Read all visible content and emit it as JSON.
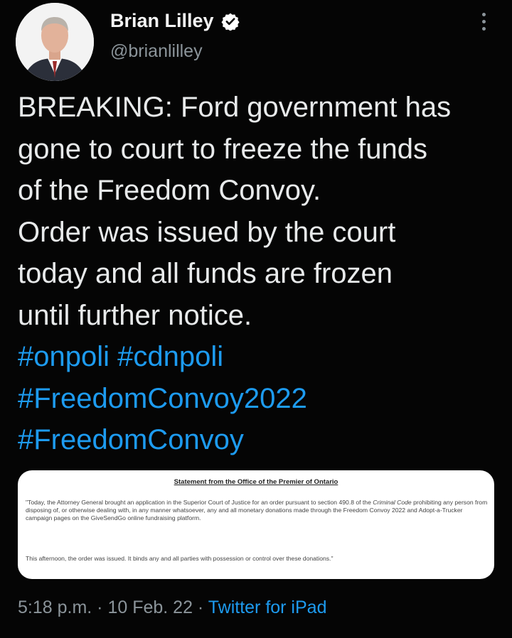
{
  "author": {
    "name": "Brian Lilley",
    "handle": "@brianlilley",
    "verified_icon": "verified-badge-icon",
    "colors": {
      "verified": "#ffffff",
      "handle": "#8b949a"
    }
  },
  "tweet": {
    "lines": [
      "BREAKING: Ford government has",
      "gone to court to freeze the funds",
      "of the Freedom Convoy.",
      "Order was issued by the court",
      "today and all funds are frozen",
      "until further notice."
    ],
    "hashtags": {
      "line1_a": "#onpoli",
      "line1_b": "#cdnpoli",
      "line2": "#FreedomConvoy2022",
      "line3": "#FreedomConvoy"
    }
  },
  "attachment": {
    "title": "Statement from the Office of the Premier of Ontario",
    "paragraph1_a": "\"Today, the Attorney General brought an application in the Superior Court of Justice for an order pursuant to section 490.8 of the ",
    "paragraph1_italic": "Criminal Code",
    "paragraph1_b": " prohibiting any person from disposing of, or otherwise dealing with, in any manner whatsoever, any and all monetary donations made through the Freedom Convoy 2022 and Adopt-a-Trucker campaign pages on the GiveSendGo online fundraising platform.",
    "paragraph2": "This afternoon, the order was issued. It binds any and all parties with possession or control over these donations.\""
  },
  "meta": {
    "time": "5:18 p.m.",
    "separator": " · ",
    "date": "10 Feb. 22",
    "source": "Twitter for iPad"
  },
  "colors": {
    "background": "#050505",
    "text": "#e8eaeb",
    "link": "#1d9bf0",
    "muted": "#8b949a"
  }
}
